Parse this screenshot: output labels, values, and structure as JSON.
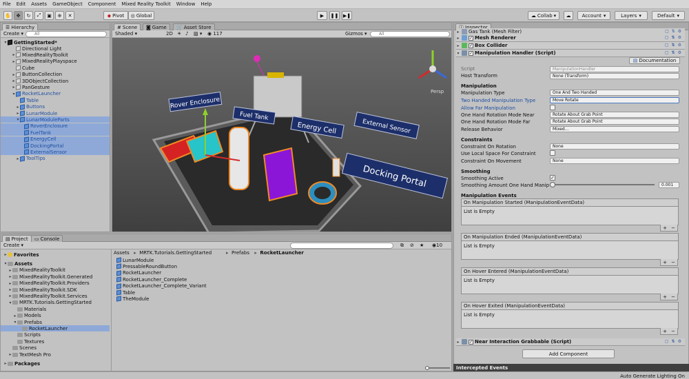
{
  "menu": [
    "File",
    "Edit",
    "Assets",
    "GameObject",
    "Component",
    "Mixed Reality Toolkit",
    "Window",
    "Help"
  ],
  "toolbar": {
    "pivot": "Pivot",
    "global": "Global",
    "collab": "Collab",
    "account": "Account",
    "layers": "Layers",
    "layout": "Default"
  },
  "hierarchy": {
    "tab": "Hierarchy",
    "create": "Create",
    "search_prefix": "All",
    "scene": "GettingStarted*",
    "items": [
      {
        "label": "Directional Light",
        "level": 2,
        "arrow": "",
        "blue": false,
        "sel": false
      },
      {
        "label": "MixedRealityToolkit",
        "level": 2,
        "arrow": "▸",
        "blue": false,
        "sel": false
      },
      {
        "label": "MixedRealityPlayspace",
        "level": 2,
        "arrow": "▸",
        "blue": false,
        "sel": false
      },
      {
        "label": "Cube",
        "level": 2,
        "arrow": "",
        "blue": false,
        "sel": false
      },
      {
        "label": "ButtonCollection",
        "level": 2,
        "arrow": "▸",
        "blue": false,
        "sel": false
      },
      {
        "label": "3DObjectCollection",
        "level": 2,
        "arrow": "▸",
        "blue": false,
        "sel": false
      },
      {
        "label": "PanGesture",
        "level": 2,
        "arrow": "▸",
        "blue": false,
        "sel": false
      },
      {
        "label": "RocketLauncher",
        "level": 2,
        "arrow": "▾",
        "blue": true,
        "sel": false
      },
      {
        "label": "Table",
        "level": 3,
        "arrow": "",
        "blue": true,
        "sel": false
      },
      {
        "label": "Buttons",
        "level": 3,
        "arrow": "▸",
        "blue": true,
        "sel": false
      },
      {
        "label": "LunarModule",
        "level": 3,
        "arrow": "▸",
        "blue": true,
        "sel": false
      },
      {
        "label": "LunarModuleParts",
        "level": 3,
        "arrow": "▾",
        "blue": true,
        "sel": true
      },
      {
        "label": "RoverEnclosure",
        "level": 4,
        "arrow": "",
        "blue": true,
        "sel": true
      },
      {
        "label": "FuelTank",
        "level": 4,
        "arrow": "",
        "blue": true,
        "sel": true
      },
      {
        "label": "EnergyCell",
        "level": 4,
        "arrow": "",
        "blue": true,
        "sel": true
      },
      {
        "label": "DockingPortal",
        "level": 4,
        "arrow": "",
        "blue": true,
        "sel": true
      },
      {
        "label": "ExternalSensor",
        "level": 4,
        "arrow": "",
        "blue": true,
        "sel": true
      },
      {
        "label": "ToolTips",
        "level": 3,
        "arrow": "▸",
        "blue": true,
        "sel": false
      }
    ]
  },
  "scene": {
    "tabs": [
      "Scene",
      "Game",
      "Asset Store"
    ],
    "shading": "Shaded",
    "mode2d": "2D",
    "gizmos": "Gizmos",
    "search_prefix": "All",
    "layer_count": "117",
    "persp": "Persp",
    "labels": [
      "Rover Enclosure",
      "Fuel Tank",
      "Energy Cell",
      "External Sensor",
      "Docking Portal"
    ]
  },
  "project": {
    "tabs": [
      "Project",
      "Console"
    ],
    "create": "Create",
    "count": "10",
    "tree": [
      {
        "label": "Favorites",
        "level": 0,
        "arrow": "▸",
        "icon": "star",
        "bold": true,
        "sel": false
      },
      {
        "label": "Assets",
        "level": 0,
        "arrow": "▾",
        "icon": "folder",
        "bold": true,
        "sel": false
      },
      {
        "label": "MixedRealityToolkit",
        "level": 1,
        "arrow": "▸",
        "icon": "folder",
        "bold": false,
        "sel": false
      },
      {
        "label": "MixedRealityToolkit.Generated",
        "level": 1,
        "arrow": "▸",
        "icon": "folder",
        "bold": false,
        "sel": false
      },
      {
        "label": "MixedRealityToolkit.Providers",
        "level": 1,
        "arrow": "▸",
        "icon": "folder",
        "bold": false,
        "sel": false
      },
      {
        "label": "MixedRealityToolkit.SDK",
        "level": 1,
        "arrow": "▸",
        "icon": "folder",
        "bold": false,
        "sel": false
      },
      {
        "label": "MixedRealityToolkit.Services",
        "level": 1,
        "arrow": "▸",
        "icon": "folder",
        "bold": false,
        "sel": false
      },
      {
        "label": "MRTK.Tutorials.GettingStarted",
        "level": 1,
        "arrow": "▾",
        "icon": "folder",
        "bold": false,
        "sel": false
      },
      {
        "label": "Materials",
        "level": 2,
        "arrow": "",
        "icon": "folder",
        "bold": false,
        "sel": false
      },
      {
        "label": "Models",
        "level": 2,
        "arrow": "▸",
        "icon": "folder",
        "bold": false,
        "sel": false
      },
      {
        "label": "Prefabs",
        "level": 2,
        "arrow": "▾",
        "icon": "folder",
        "bold": false,
        "sel": false
      },
      {
        "label": "RocketLauncher",
        "level": 3,
        "arrow": "",
        "icon": "folder",
        "bold": false,
        "sel": true
      },
      {
        "label": "Scripts",
        "level": 2,
        "arrow": "",
        "icon": "folder",
        "bold": false,
        "sel": false
      },
      {
        "label": "Textures",
        "level": 2,
        "arrow": "",
        "icon": "folder",
        "bold": false,
        "sel": false
      },
      {
        "label": "Scenes",
        "level": 1,
        "arrow": "",
        "icon": "folder",
        "bold": false,
        "sel": false
      },
      {
        "label": "TextMesh Pro",
        "level": 1,
        "arrow": "▸",
        "icon": "folder",
        "bold": false,
        "sel": false
      },
      {
        "label": "Packages",
        "level": 0,
        "arrow": "▸",
        "icon": "folder",
        "bold": true,
        "sel": false
      }
    ],
    "breadcrumb": [
      "Assets",
      "MRTK.Tutorials.GettingStarted",
      "Prefabs",
      "RocketLauncher"
    ],
    "files": [
      "LunarModule",
      "PressableRoundButton",
      "RocketLauncher",
      "RocketLauncher_Complete",
      "RocketLauncher_Complete_Variant",
      "Table",
      "TheModule"
    ]
  },
  "inspector": {
    "tab": "Inspector",
    "components_top": [
      "Gas Tank (Mesh Filter)",
      "Mesh Renderer",
      "Box Collider",
      "Manipulation Handler (Script)"
    ],
    "documentation": "Documentation",
    "script_label": "Script",
    "script_value": "ManipulationHandler",
    "host_label": "Host Transform",
    "host_value": "None (Transform)",
    "sec_manip": "Manipulation",
    "manip_type_label": "Manipulation Type",
    "manip_type_value": "One And Two Handed",
    "two_handed_label": "Two Handed Manipulation Type",
    "two_handed_value": "Move Rotate",
    "allow_far_label": "Allow Far Manipulation",
    "near_label": "One Hand Rotation Mode Near",
    "near_value": "Rotate About Grab Point",
    "far_label": "One Hand Rotation Mode Far",
    "far_value": "Rotate About Grab Point",
    "release_label": "Release Behavior",
    "release_value": "Mixed...",
    "sec_constraints": "Constraints",
    "constraint_rot_label": "Constraint On Rotation",
    "constraint_rot_value": "None",
    "local_space_label": "Use Local Space For Constraint",
    "constraint_mov_label": "Constraint On Movement",
    "constraint_mov_value": "None",
    "sec_smoothing": "Smoothing",
    "smooth_active_label": "Smoothing Active",
    "smooth_amount_label": "Smoothing Amount One Hand Manip",
    "smooth_amount_value": "0.001",
    "smooth_amount_fraction": 0.001,
    "sec_events": "Manipulation Events",
    "events": [
      {
        "title": "On Manipulation Started (ManipulationEventData)",
        "body": "List is Empty"
      },
      {
        "title": "On Manipulation Ended (ManipulationEventData)",
        "body": "List is Empty"
      },
      {
        "title": "On Hover Entered (ManipulationEventData)",
        "body": "List is Empty"
      },
      {
        "title": "On Hover Exited (ManipulationEventData)",
        "body": "List is Empty"
      }
    ],
    "near_grab": "Near Interaction Grabbable (Script)",
    "add_component": "Add Component",
    "intercepted": "Intercepted Events"
  },
  "status": {
    "text": "Auto Generate Lighting On"
  }
}
